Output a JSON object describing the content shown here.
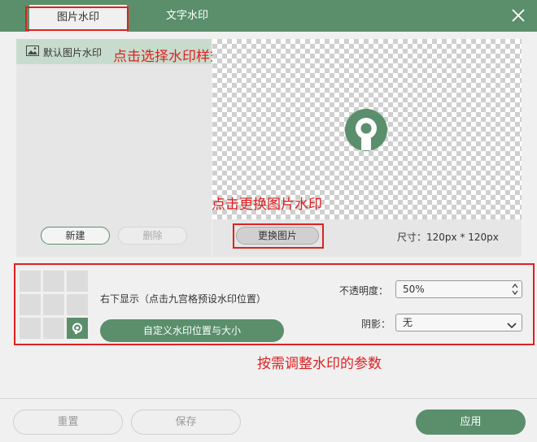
{
  "tabs": {
    "image_watermark": "图片水印",
    "text_watermark": "文字水印"
  },
  "list": {
    "default_item": "默认图片水印"
  },
  "annotations": {
    "select_style": "点击选择水印样式",
    "change_image": "点击更换图片水印",
    "adjust_params": "按需调整水印的参数"
  },
  "buttons": {
    "new": "新建",
    "delete": "删除",
    "change_image": "更换图片",
    "custom_position": "自定义水印位置与大小",
    "reset": "重置",
    "save": "保存",
    "apply": "应用"
  },
  "size": {
    "text": "尺寸：120px * 120px"
  },
  "position": {
    "text": "右下显示（点击九宫格预设水印位置）",
    "active_cell": "bottom-right"
  },
  "opacity": {
    "label": "不透明度：",
    "value": "50%"
  },
  "shadow": {
    "label": "阴影：",
    "value": "无"
  },
  "colors": {
    "brand": "#5b8f6c",
    "annotation": "#e02020"
  }
}
